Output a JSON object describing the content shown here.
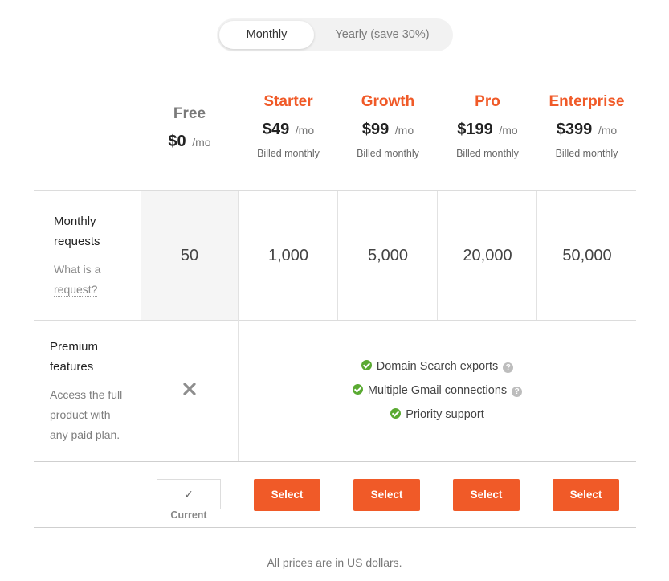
{
  "toggle": {
    "monthly_label": "Monthly",
    "yearly_label": "Yearly (save 30%)",
    "selected": "Monthly"
  },
  "plans": [
    {
      "name": "Free",
      "price": "$0",
      "unit": "/mo",
      "billing": "",
      "requests": "50"
    },
    {
      "name": "Starter",
      "price": "$49",
      "unit": "/mo",
      "billing": "Billed monthly",
      "requests": "1,000"
    },
    {
      "name": "Growth",
      "price": "$99",
      "unit": "/mo",
      "billing": "Billed monthly",
      "requests": "5,000"
    },
    {
      "name": "Pro",
      "price": "$199",
      "unit": "/mo",
      "billing": "Billed monthly",
      "requests": "20,000"
    },
    {
      "name": "Enterprise",
      "price": "$399",
      "unit": "/mo",
      "billing": "Billed monthly",
      "requests": "50,000"
    }
  ],
  "rows": {
    "requests": {
      "title_line1": "Monthly",
      "title_line2": "requests",
      "link_line1": "What is a",
      "link_line2": "request?"
    },
    "premium": {
      "title_line1": "Premium",
      "title_line2": "features",
      "desc_line1": "Access the full",
      "desc_line2": "product with",
      "desc_line3": "any paid plan.",
      "features": [
        {
          "label": "Domain Search exports",
          "help": true
        },
        {
          "label": "Multiple Gmail connections",
          "help": true
        },
        {
          "label": "Priority support",
          "help": false
        }
      ]
    }
  },
  "actions": {
    "current_mark": "✓",
    "current_label": "Current",
    "select_label": "Select"
  },
  "footer": {
    "note": "All prices are in US dollars."
  },
  "colors": {
    "accent": "#f05a28",
    "check": "#5aaa32",
    "free_column_bg": "#f5f5f5"
  }
}
